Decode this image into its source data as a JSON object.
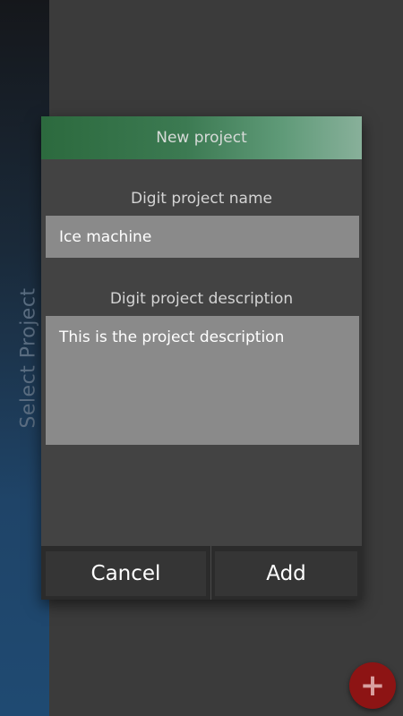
{
  "sidebar": {
    "label": "Select Project"
  },
  "dialog": {
    "title": "New project",
    "name_label": "Digit project name",
    "name_value": "Ice machine",
    "description_label": "Digit project description",
    "description_value": "This is the project description",
    "cancel_label": "Cancel",
    "add_label": "Add"
  },
  "fab": {
    "icon": "plus-icon",
    "glyph": "+"
  },
  "colors": {
    "header_accent": "#2c6a3e",
    "fab": "#8d1414",
    "sidebar_accent": "#1f4a72"
  }
}
